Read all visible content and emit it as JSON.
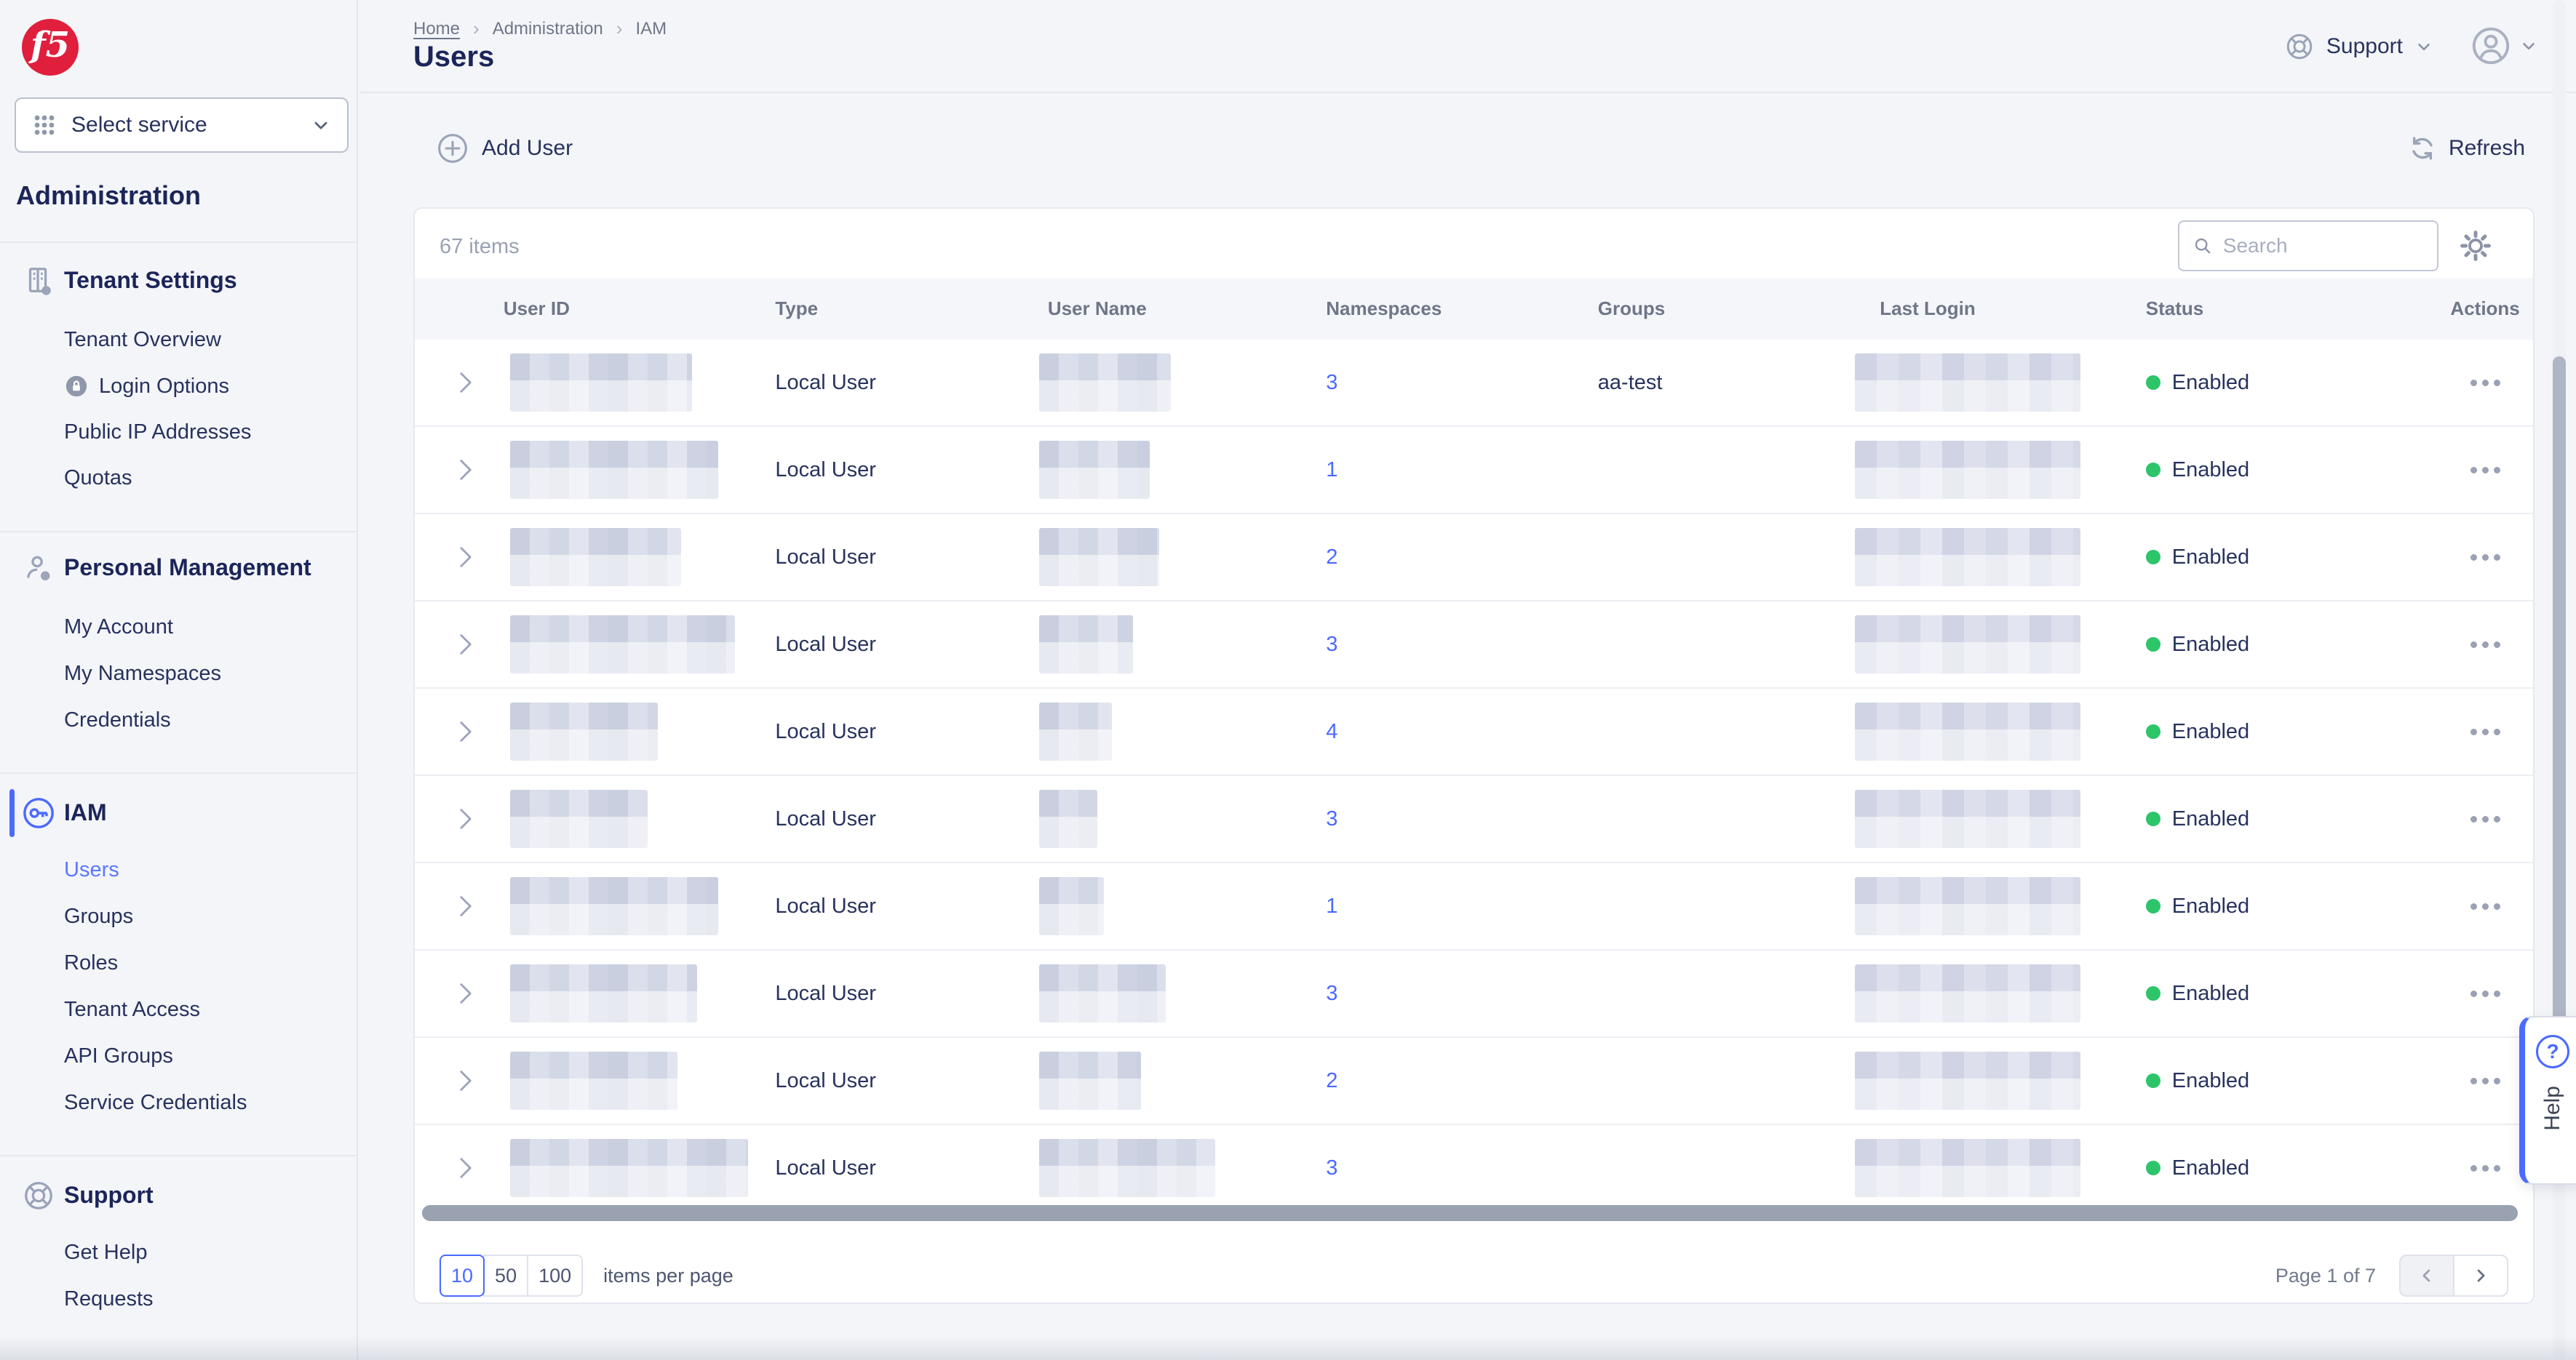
{
  "colors": {
    "accent": "#4b6aff",
    "status_enabled": "#2cc56a",
    "logo_red": "#e01f3d"
  },
  "brand": {
    "logo_text": "f5"
  },
  "sidebar": {
    "select_service": "Select service",
    "heading": "Administration",
    "sections": [
      {
        "title": "Tenant Settings",
        "icon": "building-gear-icon",
        "items": [
          {
            "label": "Tenant Overview"
          },
          {
            "label": "Login Options",
            "icon": "lock-icon"
          },
          {
            "label": "Public IP Addresses"
          },
          {
            "label": "Quotas"
          }
        ]
      },
      {
        "title": "Personal Management",
        "icon": "person-gear-icon",
        "items": [
          {
            "label": "My Account"
          },
          {
            "label": "My Namespaces"
          },
          {
            "label": "Credentials"
          }
        ]
      },
      {
        "title": "IAM",
        "icon": "key-icon",
        "active": true,
        "items": [
          {
            "label": "Users",
            "active": true
          },
          {
            "label": "Groups"
          },
          {
            "label": "Roles"
          },
          {
            "label": "Tenant Access"
          },
          {
            "label": "API Groups"
          },
          {
            "label": "Service Credentials"
          }
        ]
      },
      {
        "title": "Support",
        "icon": "lifebuoy-icon",
        "items": [
          {
            "label": "Get Help"
          },
          {
            "label": "Requests"
          }
        ]
      }
    ]
  },
  "header": {
    "breadcrumb": [
      "Home",
      "Administration",
      "IAM"
    ],
    "title": "Users",
    "support_label": "Support"
  },
  "toolbar": {
    "add_user": "Add User",
    "refresh": "Refresh"
  },
  "table": {
    "items_count": "67 items",
    "search_placeholder": "Search",
    "columns": [
      "User ID",
      "Type",
      "User Name",
      "Namespaces",
      "Groups",
      "Last Login",
      "Status",
      "Actions"
    ],
    "rows": [
      {
        "type": "Local User",
        "namespaces": "3",
        "groups": "aa-test",
        "status": "Enabled"
      },
      {
        "type": "Local User",
        "namespaces": "1",
        "groups": "",
        "status": "Enabled"
      },
      {
        "type": "Local User",
        "namespaces": "2",
        "groups": "",
        "status": "Enabled"
      },
      {
        "type": "Local User",
        "namespaces": "3",
        "groups": "",
        "status": "Enabled"
      },
      {
        "type": "Local User",
        "namespaces": "4",
        "groups": "",
        "status": "Enabled"
      },
      {
        "type": "Local User",
        "namespaces": "3",
        "groups": "",
        "status": "Enabled"
      },
      {
        "type": "Local User",
        "namespaces": "1",
        "groups": "",
        "status": "Enabled"
      },
      {
        "type": "Local User",
        "namespaces": "3",
        "groups": "",
        "status": "Enabled"
      },
      {
        "type": "Local User",
        "namespaces": "2",
        "groups": "",
        "status": "Enabled"
      },
      {
        "type": "Local User",
        "namespaces": "3",
        "groups": "",
        "status": "Enabled"
      }
    ]
  },
  "pagination": {
    "sizes": [
      "10",
      "50",
      "100"
    ],
    "selected_size": "10",
    "items_per_page_label": "items per page",
    "page_info": "Page 1 of 7"
  },
  "help": {
    "label": "Help"
  }
}
